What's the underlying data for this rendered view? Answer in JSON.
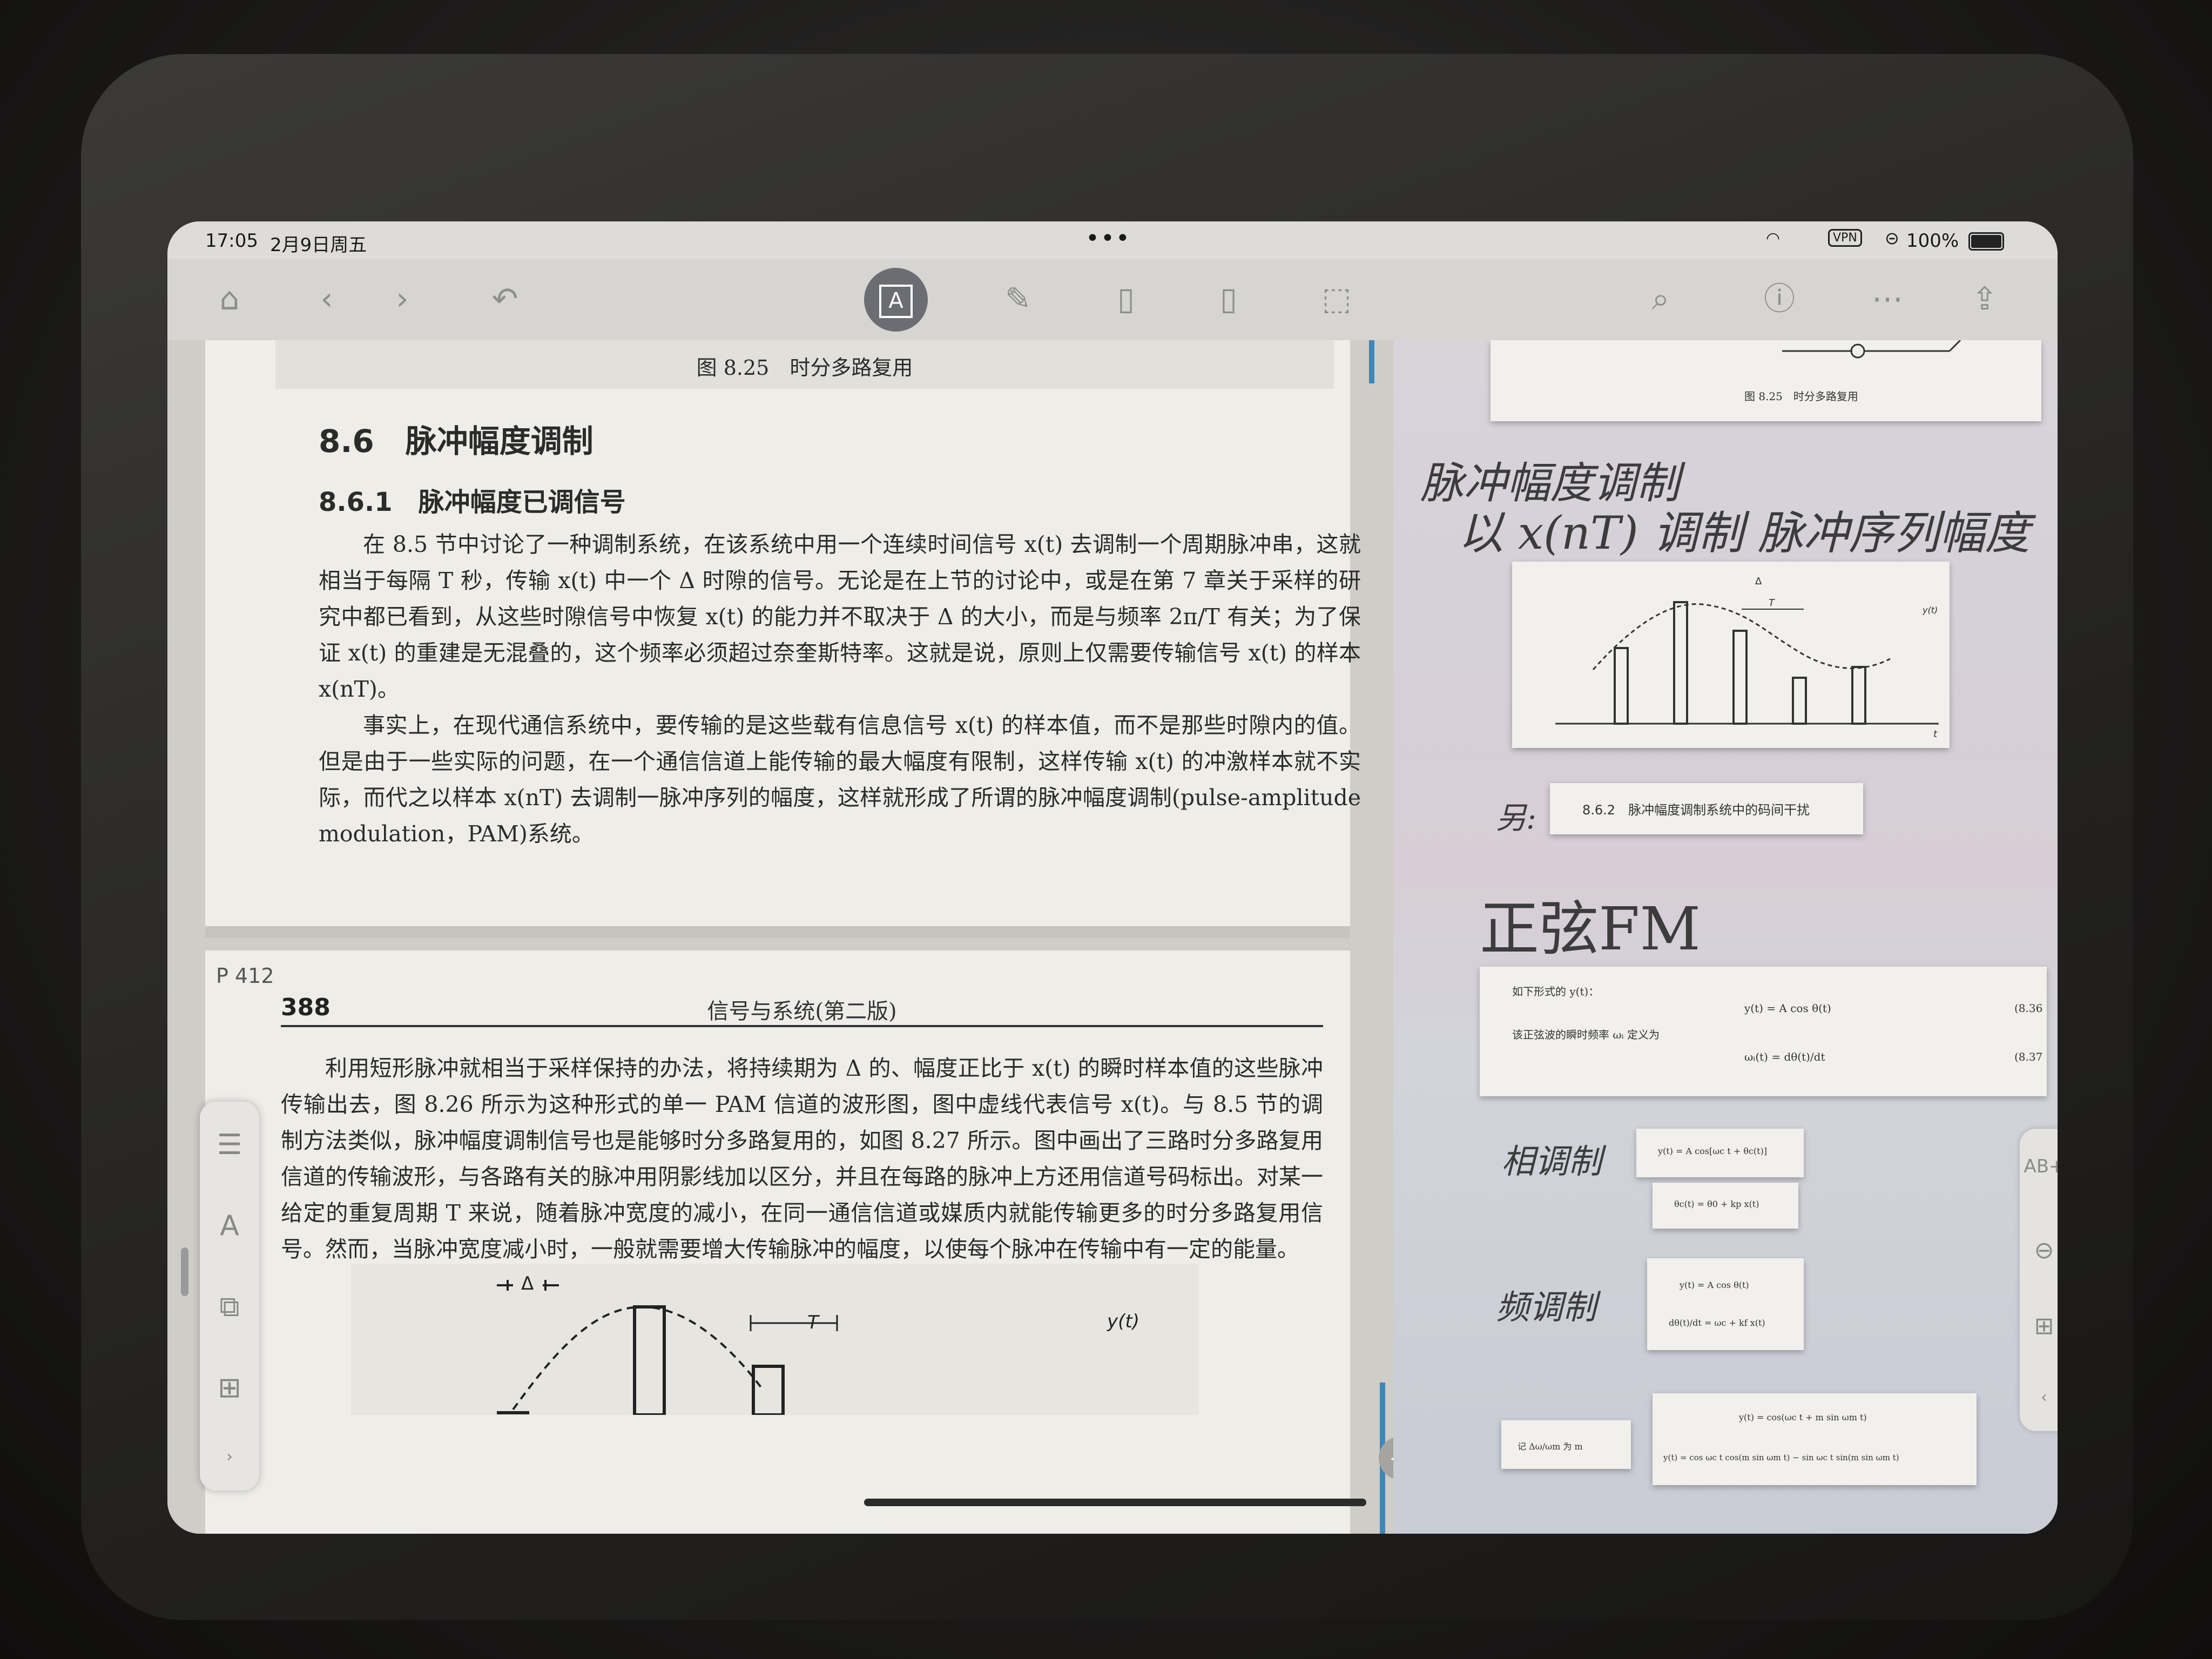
{
  "status_bar": {
    "time": "17:05",
    "date": "2月9日周五",
    "vpn": "VPN",
    "battery": "100%"
  },
  "toolbar": {
    "active_tool": "text-tool"
  },
  "left_page": {
    "figure_caption": "图 8.25　时分多路复用",
    "section_title": "8.6　脉冲幅度调制",
    "subsection_title": "8.6.1　脉冲幅度已调信号",
    "paragraphs": [
      "在 8.5 节中讨论了一种调制系统，在该系统中用一个连续时间信号 x(t) 去调制一个周期脉冲串，这就相当于每隔 T 秒，传输 x(t) 中一个 Δ 时隙的信号。无论是在上节的讨论中，或是在第 7 章关于采样的研究中都已看到，从这些时隙信号中恢复 x(t) 的能力并不取决于 Δ 的大小，而是与频率 2π/T 有关；为了保证 x(t) 的重建是无混叠的，这个频率必须超过奈奎斯特率。这就是说，原则上仅需要传输信号 x(t) 的样本 x(nT)。",
      "事实上，在现代通信系统中，要传输的是这些载有信息信号 x(t) 的样本值，而不是那些时隙内的值。但是由于一些实际的问题，在一个通信信道上能传输的最大幅度有限制，这样传输 x(t) 的冲激样本就不实际，而代之以样本 x(nT) 去调制一脉冲序列的幅度，这样就形成了所谓的脉冲幅度调制(pulse-amplitude modulation，PAM)系统。"
    ],
    "page_label": "P 412",
    "page_number": "388",
    "book_title": "信号与系统(第二版)",
    "paragraphs_2": [
      "利用短形脉冲就相当于采样保持的办法，将持续期为 Δ 的、幅度正比于 x(t) 的瞬时样本值的这些脉冲传输出去，图 8.26 所示为这种形式的单一 PAM 信道的波形图，图中虚线代表信号 x(t)。与 8.5 节的调制方法类似，脉冲幅度调制信号也是能够时分多路复用的，如图 8.27 所示。图中画出了三路时分多路复用信道的传输波形，与各路有关的脉冲用阴影线加以区分，并且在每路的脉冲上方还用信道号码标出。对某一给定的重复周期 T 来说，随着脉冲宽度的减小，在同一通信信道或媒质内就能传输更多的时分多路复用信号。然而，当脉冲宽度减小时，一般就需要增大传输脉冲的幅度，以使每个脉冲在传输中有一定的能量。"
    ],
    "fig_labels": {
      "delta": "Δ",
      "period": "T",
      "signal": "y(t)"
    }
  },
  "notes": {
    "top_card_caption": "图 8.25　时分多路复用",
    "handwriting_1": "脉冲幅度调制",
    "handwriting_2": "以 x(nT) 调制 脉冲序列幅度",
    "chart_labels": {
      "delta": "Δ",
      "period": "T",
      "signal": "y(t)",
      "taxis": "t"
    },
    "handwriting_3": "另:",
    "card_862": "8.6.2　脉冲幅度调制系统中的码间干扰",
    "handwriting_4": "正弦FM",
    "fm_line1": "如下形式的 y(t)：",
    "fm_eq1": "y(t) = A cos θ(t)",
    "fm_eqnum1": "(8.36",
    "fm_line2": "该正弦波的瞬时频率 ωᵢ 定义为",
    "fm_eq2": "ωᵢ(t) = dθ(t)/dt",
    "fm_eqnum2": "(8.37",
    "handwriting_5": "相调制",
    "pm_eq1": "y(t) = A cos[ωc t + θc(t)]",
    "pm_eq2": "θc(t) = θ0 + kp x(t)",
    "handwriting_6": "频调制",
    "fmod_eq1": "y(t) = A cos θ(t)",
    "fmod_eq2": "dθ(t)/dt = ωc + kf x(t)",
    "mi_label": "记 Δω/ωm 为 m",
    "sine_eq1": "y(t) = cos(ωc t + m sin ωm t)",
    "sine_eq2": "y(t) = cos ωc t cos(m sin ωm t) − sin ωc t sin(m sin ωm t)"
  },
  "colors": {
    "accent_line": "#3f87b7",
    "active_tool_bg": "#6b6d73"
  }
}
